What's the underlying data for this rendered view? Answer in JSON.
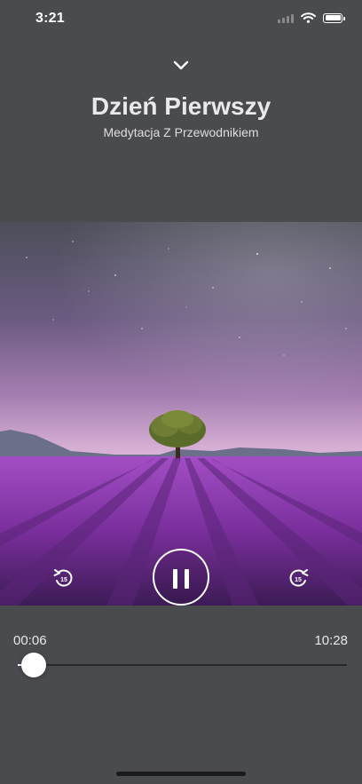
{
  "status_bar": {
    "time": "3:21",
    "icons": [
      "signal-icon",
      "wifi-icon",
      "battery-icon"
    ]
  },
  "player": {
    "collapse_icon": "chevron-down-icon",
    "title": "Dzień Pierwszy",
    "subtitle": "Medytacja Z Przewodnikiem",
    "artwork": "lavender-field-tree-starry-sky",
    "controls": {
      "rewind": {
        "icon": "rewind-15-icon",
        "seconds": "15"
      },
      "play_pause": {
        "icon": "pause-icon",
        "state": "playing"
      },
      "forward": {
        "icon": "forward-15-icon",
        "seconds": "15"
      }
    },
    "progress": {
      "current": "00:06",
      "total": "10:28",
      "fraction": 0.0096
    }
  },
  "colors": {
    "background": "#4a4b4f",
    "title": "#e9e9ec",
    "track": "#28292c",
    "thumb": "#ffffff"
  }
}
